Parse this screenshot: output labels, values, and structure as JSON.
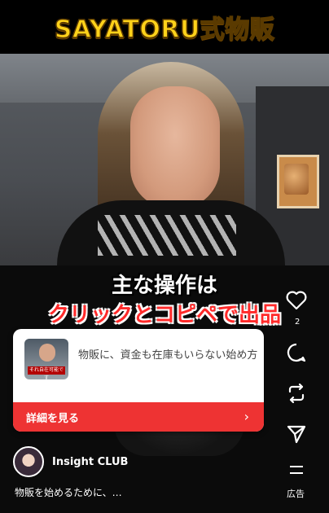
{
  "banner": {
    "title": "SAYATORU式物販"
  },
  "captions": {
    "line1": "主な操作は",
    "line2": "クリックとコピペで出品"
  },
  "ad_card": {
    "thumbnail_text": "それ自在可能です",
    "description": "物販に、資金も在庫もいらない始め方",
    "cta_label": "詳細を見る",
    "cta_chevron": "›"
  },
  "account": {
    "name": "Insight CLUB",
    "body": "物販を始めるために、…"
  },
  "rail": {
    "like_count": "2",
    "ad_label": "広告"
  },
  "colors": {
    "accent": "#ee3333",
    "banner_text": "#ffd21a",
    "caption_red": "#ff2a2a"
  }
}
